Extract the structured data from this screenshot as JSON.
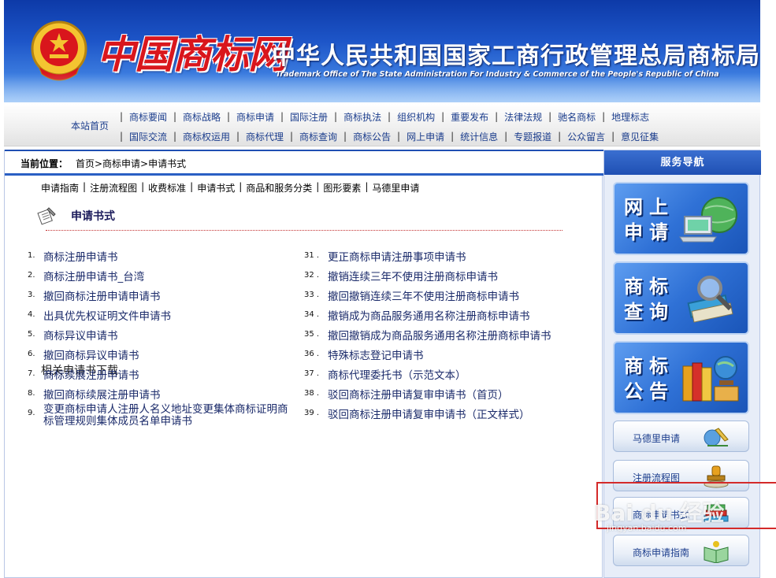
{
  "header": {
    "logo_text": "中国商标网",
    "title": "中华人民共和国国家工商行政管理总局商标局",
    "subtitle": "Trademark Office of The State Administration For Industry & Commerce of the People's Republic of China"
  },
  "nav": {
    "home": "本站首页",
    "row1": [
      "商标要闻",
      "商标战略",
      "商标申请",
      "国际注册",
      "商标执法",
      "组织机构",
      "重要发布",
      "法律法规",
      "驰名商标",
      "地理标志"
    ],
    "row2": [
      "国际交流",
      "商标权运用",
      "商标代理",
      "商标查询",
      "商标公告",
      "网上申请",
      "统计信息",
      "专题报道",
      "公众留言",
      "意见征集"
    ]
  },
  "breadcrumb": {
    "label": "当前位置：",
    "path": "首页>商标申请>申请书式"
  },
  "subnav": [
    "申请指南",
    "注册流程图",
    "收费标准",
    "申请书式",
    "商品和服务分类",
    "图形要素",
    "马德里申请"
  ],
  "section": {
    "title": "申请书式",
    "downloads_title": "相关申请书下载"
  },
  "downloads_left": [
    {
      "num": "1.",
      "text": "商标注册申请书"
    },
    {
      "num": "2.",
      "text": "商标注册申请书_台湾"
    },
    {
      "num": "3.",
      "text": "撤回商标注册申请申请书"
    },
    {
      "num": "4.",
      "text": "出具优先权证明文件申请书"
    },
    {
      "num": "5.",
      "text": "商标异议申请书"
    },
    {
      "num": "6.",
      "text": "撤回商标异议申请书"
    },
    {
      "num": "7.",
      "text": "商标续展注册申请书"
    },
    {
      "num": "8.",
      "text": "撤回商标续展注册申请书"
    },
    {
      "num": "9.",
      "text": "变更商标申请人注册人名义地址变更集体商标证明商标管理规则集体成员名单申请书"
    }
  ],
  "downloads_right": [
    {
      "num": "31 .",
      "text": "更正商标申请注册事项申请书"
    },
    {
      "num": "32 .",
      "text": "撤销连续三年不使用注册商标申请书"
    },
    {
      "num": "33 .",
      "text": "撤回撤销连续三年不使用注册商标申请书"
    },
    {
      "num": "34 .",
      "text": "撤销成为商品服务通用名称注册商标申请书"
    },
    {
      "num": "35 .",
      "text": "撤回撤销成为商品服务通用名称注册商标申请书"
    },
    {
      "num": "36 .",
      "text": "特殊标志登记申请书"
    },
    {
      "num": "37 .",
      "text": "商标代理委托书（示范文本）"
    },
    {
      "num": "38 .",
      "text": "驳回商标注册申请复审申请书（首页）"
    },
    {
      "num": "39 .",
      "text": "驳回商标注册申请复审申请书（正文样式）"
    }
  ],
  "sidebar": {
    "title": "服务导航",
    "tiles": [
      {
        "label": "网上申请",
        "glyphs": "网上申请"
      },
      {
        "label": "商标查询",
        "glyphs": "商标查询"
      },
      {
        "label": "商标公告",
        "glyphs": "商标公告"
      }
    ],
    "buttons": [
      "马德里申请",
      "注册流程图",
      "商标申请书式",
      "商标申请指南"
    ]
  },
  "watermark": {
    "text": "Bai du 经验",
    "sub": "jingyan.baidu.com"
  },
  "colors": {
    "banner": "#1d55c8",
    "accent": "#2a5fc4",
    "logo_red": "#d9161c",
    "link": "#1a3c8c",
    "highlight": "#d42a2a"
  }
}
